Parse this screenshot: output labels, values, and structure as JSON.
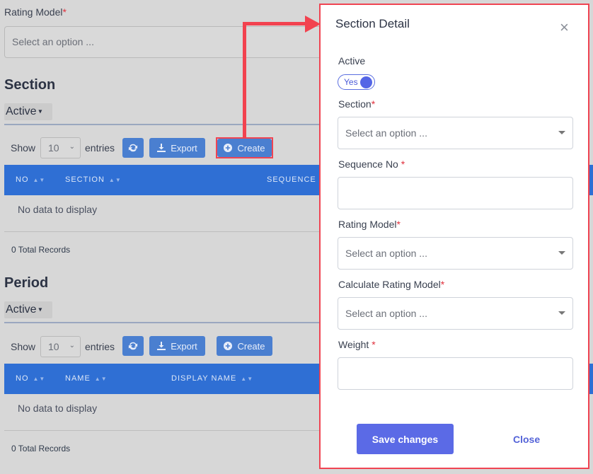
{
  "background": {
    "rating_model_label": "Rating Model",
    "required_mark": "*",
    "rating_model_placeholder": "Select an option ...",
    "sections": [
      {
        "title": "Section",
        "filter": "Active",
        "show_label": "Show",
        "entries_value": "10",
        "entries_label": "entries",
        "export_label": "Export",
        "create_label": "Create",
        "columns": [
          "NO",
          "SECTION",
          "SEQUENCE N"
        ],
        "empty_text": "No data to display",
        "total": "0 Total Records"
      },
      {
        "title": "Period",
        "filter": "Active",
        "show_label": "Show",
        "entries_value": "10",
        "entries_label": "entries",
        "export_label": "Export",
        "create_label": "Create",
        "columns": [
          "NO",
          "NAME",
          "DISPLAY NAME"
        ],
        "empty_text": "No data to display",
        "total": "0 Total Records"
      }
    ]
  },
  "modal": {
    "title": "Section Detail",
    "close_icon": "close-icon",
    "active_label": "Active",
    "toggle_text": "Yes",
    "fields": [
      {
        "label": "Section",
        "required": "*",
        "type": "select",
        "placeholder": "Select an option ...",
        "value": ""
      },
      {
        "label": "Sequence No ",
        "required": "*",
        "type": "text",
        "placeholder": "",
        "value": ""
      },
      {
        "label": "Rating Model",
        "required": "*",
        "type": "select",
        "placeholder": "Select an option ...",
        "value": ""
      },
      {
        "label": "Calculate Rating Model",
        "required": "*",
        "type": "select",
        "placeholder": "Select an option ...",
        "value": ""
      },
      {
        "label": "Weight ",
        "required": "*",
        "type": "text",
        "placeholder": "",
        "value": ""
      }
    ],
    "save_label": "Save changes",
    "close_label": "Close"
  },
  "colors": {
    "primary_blue": "#2f6fd4",
    "modal_accent": "#5b6ae6",
    "highlight_red": "#f04452"
  }
}
